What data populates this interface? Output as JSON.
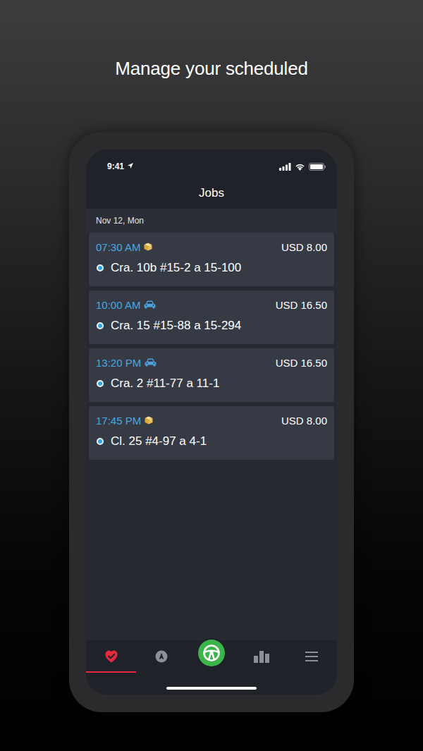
{
  "headline": "Manage your scheduled",
  "status_bar": {
    "time": "9:41"
  },
  "header": {
    "title": "Jobs"
  },
  "date": "Nov 12, Mon",
  "jobs": [
    {
      "time": "07:30 AM",
      "kind": "package",
      "price": "USD 8.00",
      "address": "Cra. 10b #15-2 a 15-100"
    },
    {
      "time": "10:00 AM",
      "kind": "car",
      "price": "USD 16.50",
      "address": "Cra. 15 #15-88 a 15-294"
    },
    {
      "time": "13:20 PM",
      "kind": "car",
      "price": "USD 16.50",
      "address": "Cra. 2 #11-77 a 11-1"
    },
    {
      "time": "17:45 PM",
      "kind": "package",
      "price": "USD 8.00",
      "address": "Cl. 25 #4-97 a 4-1"
    }
  ],
  "tabs": [
    {
      "kind": "jobs",
      "selected": true
    },
    {
      "kind": "navigate",
      "selected": false
    },
    {
      "kind": "drive",
      "selected": false
    },
    {
      "kind": "stats",
      "selected": false
    },
    {
      "kind": "menu",
      "selected": false
    }
  ]
}
